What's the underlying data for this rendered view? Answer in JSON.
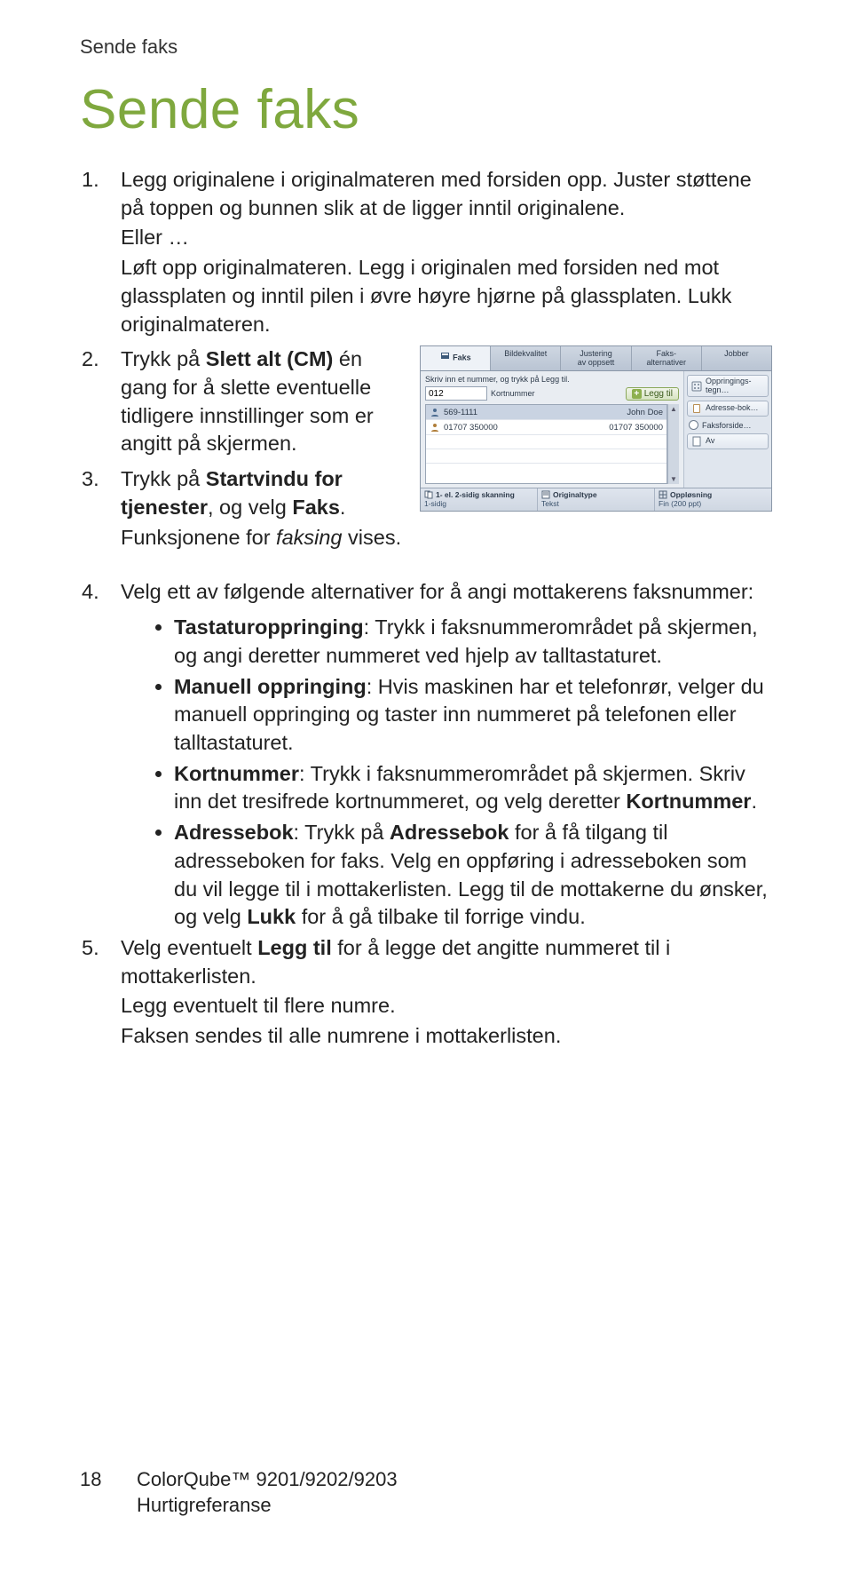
{
  "running_head": "Sende faks",
  "title": "Sende faks",
  "steps": {
    "s1": {
      "num": "1.",
      "l1": "Legg originalene i originalmateren med forsiden opp. Juster støttene på toppen og bunnen slik at de ligger inntil originalene.",
      "l2": "Eller …",
      "l3": "Løft opp originalmateren. Legg i originalen med forsiden ned mot glassplaten og inntil pilen i øvre høyre hjørne på glassplaten. Lukk originalmateren."
    },
    "s2": {
      "num": "2.",
      "pre": "Trykk på ",
      "bold": "Slett alt (CM)",
      "post": " én gang for å slette eventuelle tidligere innstillinger som er angitt på skjermen."
    },
    "s3": {
      "num": "3.",
      "pre": "Trykk på ",
      "bold1": "Startvindu for tjenester",
      "mid": ", og velg ",
      "bold2": "Faks",
      "post1": ".",
      "post2_pre": "Funksjonene for ",
      "post2_it": "faksing",
      "post2_post": " vises."
    },
    "s4": {
      "num": "4.",
      "lead": "Velg ett av følgende alternativer for å angi mottakerens faksnummer:",
      "b1_bold": "Tastaturoppringing",
      "b1_rest": ": Trykk i faksnummerområdet på skjermen, og angi deretter nummeret ved hjelp av talltastaturet.",
      "b2_bold": "Manuell oppringing",
      "b2_rest": ": Hvis maskinen har et telefonrør, velger du manuell oppringing og taster inn nummeret på telefonen eller talltastaturet.",
      "b3_bold": "Kortnummer",
      "b3_mid": ": Trykk i faksnummerområdet på skjermen. Skriv inn det tresifrede kortnummeret, og velg deretter ",
      "b3_bold2": "Kortnummer",
      "b3_end": ".",
      "b4_bold": "Adressebok",
      "b4_a": ": Trykk på ",
      "b4_bold2": "Adressebok",
      "b4_b": " for å få tilgang til adresseboken for faks. Velg en oppføring i adresseboken som du vil legge til i mottakerlisten. Legg til de mottakerne du ønsker, og velg ",
      "b4_bold3": "Lukk",
      "b4_c": " for å gå tilbake til forrige vindu."
    },
    "s5": {
      "num": "5.",
      "pre": "Velg eventuelt ",
      "bold": "Legg til",
      "post": " for å legge det angitte nummeret til i mottakerlisten.",
      "l2": "Legg eventuelt til flere numre.",
      "l3": "Faksen sendes til alle numrene i mottakerlisten."
    }
  },
  "footer": {
    "page": "18",
    "line1": "ColorQube™ 9201/9202/9203",
    "line2": "Hurtigreferanse"
  },
  "faksui": {
    "tabs": {
      "t1": "Faks",
      "t2": "Bildekvalitet",
      "t3a": "Justering",
      "t3b": "av oppsett",
      "t4a": "Faks-",
      "t4b": "alternativer",
      "t5": "Jobber"
    },
    "hint": "Skriv inn et nummer, og trykk på Legg til.",
    "num_value": "012",
    "kortnummer": "Kortnummer",
    "legg_til": "Legg til",
    "rows": {
      "r1_num": "569-1111",
      "r1_name": "John Doe",
      "r2_num": "01707 350000",
      "r2_name": "01707 350000"
    },
    "side": {
      "oppringings": "Oppringings-tegn…",
      "adressebok": "Adresse-bok…",
      "faksforside": "Faksforside…",
      "av": "Av"
    },
    "bottom": {
      "c1_lab": "1- el. 2-sidig skanning",
      "c1_val": "1-sidig",
      "c2_lab": "Originaltype",
      "c2_val": "Tekst",
      "c3_lab": "Oppløsning",
      "c3_val": "Fin (200 ppt)"
    }
  }
}
